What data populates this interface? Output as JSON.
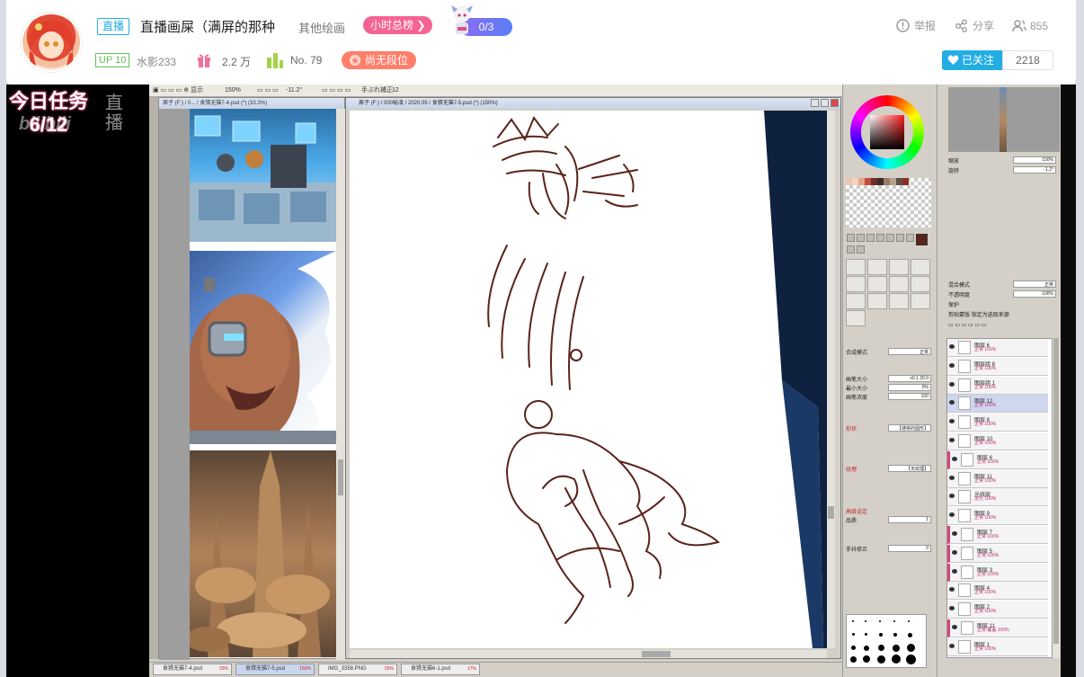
{
  "header": {
    "live_tag": "直播",
    "room_title": "直播画屎（满屏的那种",
    "area": "其他绘画",
    "hour_rank": "小时总榜",
    "rank_badge_text": "0/3",
    "up_level": "UP 10",
    "up_name": "水影233",
    "gift_count": "2.2 万",
    "rank_no": "No. 79",
    "tier": "尚无段位",
    "report": "举报",
    "share": "分享",
    "viewers": "855",
    "follow_label": "已关注",
    "follow_count": "2218",
    "accent": "#23ade5"
  },
  "player": {
    "task_line1": "今日任务",
    "task_line2": "6/12",
    "watermark": "bilibili",
    "live_watermark": "直播",
    "sai": {
      "toolbar": {
        "zoom": "150%",
        "angle": "-11.2°",
        "stabilizer_label": "手ぶれ補正",
        "stabilizer_value": "12"
      },
      "docA_title": "扉子 (F:) / 0... / 食猎无猫7-4.psd (*) (33.3%)",
      "docB_title": "扉子 (F:) / 000秘凌 / 2020.05 / 食猎无猫7-5.psd (*) (150%)",
      "tool_props": [
        {
          "label": "合成模式",
          "value": "正常"
        },
        {
          "label": "画笔大小",
          "value": "x0.1   20.0"
        },
        {
          "label": "最小大小",
          "value": "0%"
        },
        {
          "label": "画笔浓度",
          "value": "100"
        },
        {
          "label": "形状",
          "value": "【通常的圆形】",
          "section": true
        },
        {
          "label": "纹理",
          "value": "【无纹理】",
          "section": true
        },
        {
          "label": "高级设定",
          "value": "",
          "section": true
        },
        {
          "label": "品质",
          "value": "1"
        },
        {
          "label": "手抖修正",
          "value": "0"
        }
      ],
      "layers": [
        {
          "name": "图层 6",
          "mode": "正常",
          "opacity": "100%"
        },
        {
          "name": "图层组 8",
          "mode": "正常",
          "opacity": "100%"
        },
        {
          "name": "图层组 1",
          "mode": "正常",
          "opacity": "100%"
        },
        {
          "name": "图层 12",
          "mode": "正常",
          "opacity": "100%",
          "selected": true
        },
        {
          "name": "图层 8",
          "mode": "正常",
          "opacity": "100%"
        },
        {
          "name": "图层 10",
          "mode": "正常",
          "opacity": "100%"
        },
        {
          "name": "图层 6",
          "mode": "正常",
          "opacity": "100%",
          "marked": true
        },
        {
          "name": "图层 11",
          "mode": "正常",
          "opacity": "100%"
        },
        {
          "name": "光线层",
          "mode": "发光",
          "opacity": "100%"
        },
        {
          "name": "图层 9",
          "mode": "正常",
          "opacity": "100%"
        },
        {
          "name": "图层 7",
          "mode": "正常",
          "opacity": "100%",
          "marked": true
        },
        {
          "name": "图层 5",
          "mode": "正常",
          "opacity": "100%",
          "marked": true
        },
        {
          "name": "图层 3",
          "mode": "正常",
          "opacity": "100%",
          "marked": true
        },
        {
          "name": "图层 4",
          "mode": "正常",
          "opacity": "100%"
        },
        {
          "name": "图层 2",
          "mode": "正常",
          "opacity": "100%"
        },
        {
          "name": "图层 11",
          "mode": "正常 覆盖",
          "opacity": "100%",
          "marked": true
        },
        {
          "name": "图层 1",
          "mode": "正常",
          "opacity": "100%"
        }
      ],
      "layer_props": {
        "blend_label": "混合模式",
        "blend_value": "正常",
        "opacity_label": "不透明度",
        "opacity_value": "100%",
        "protect_label": "保护",
        "clip_label": "剪贴蒙版",
        "sample_label": "指定为选取来源"
      },
      "file_tabs": [
        {
          "name": "食猎无猫7-4.psd",
          "pct": "33%"
        },
        {
          "name": "食猎无猫7-5.psd",
          "pct": "150%",
          "active": true
        },
        {
          "name": "IMG_3358.PNG",
          "pct": "50%"
        },
        {
          "name": "食猎无猫6-1.psd",
          "pct": "17%"
        }
      ],
      "nav_zoom": "150%",
      "nav_angle": "-1.2°"
    }
  }
}
